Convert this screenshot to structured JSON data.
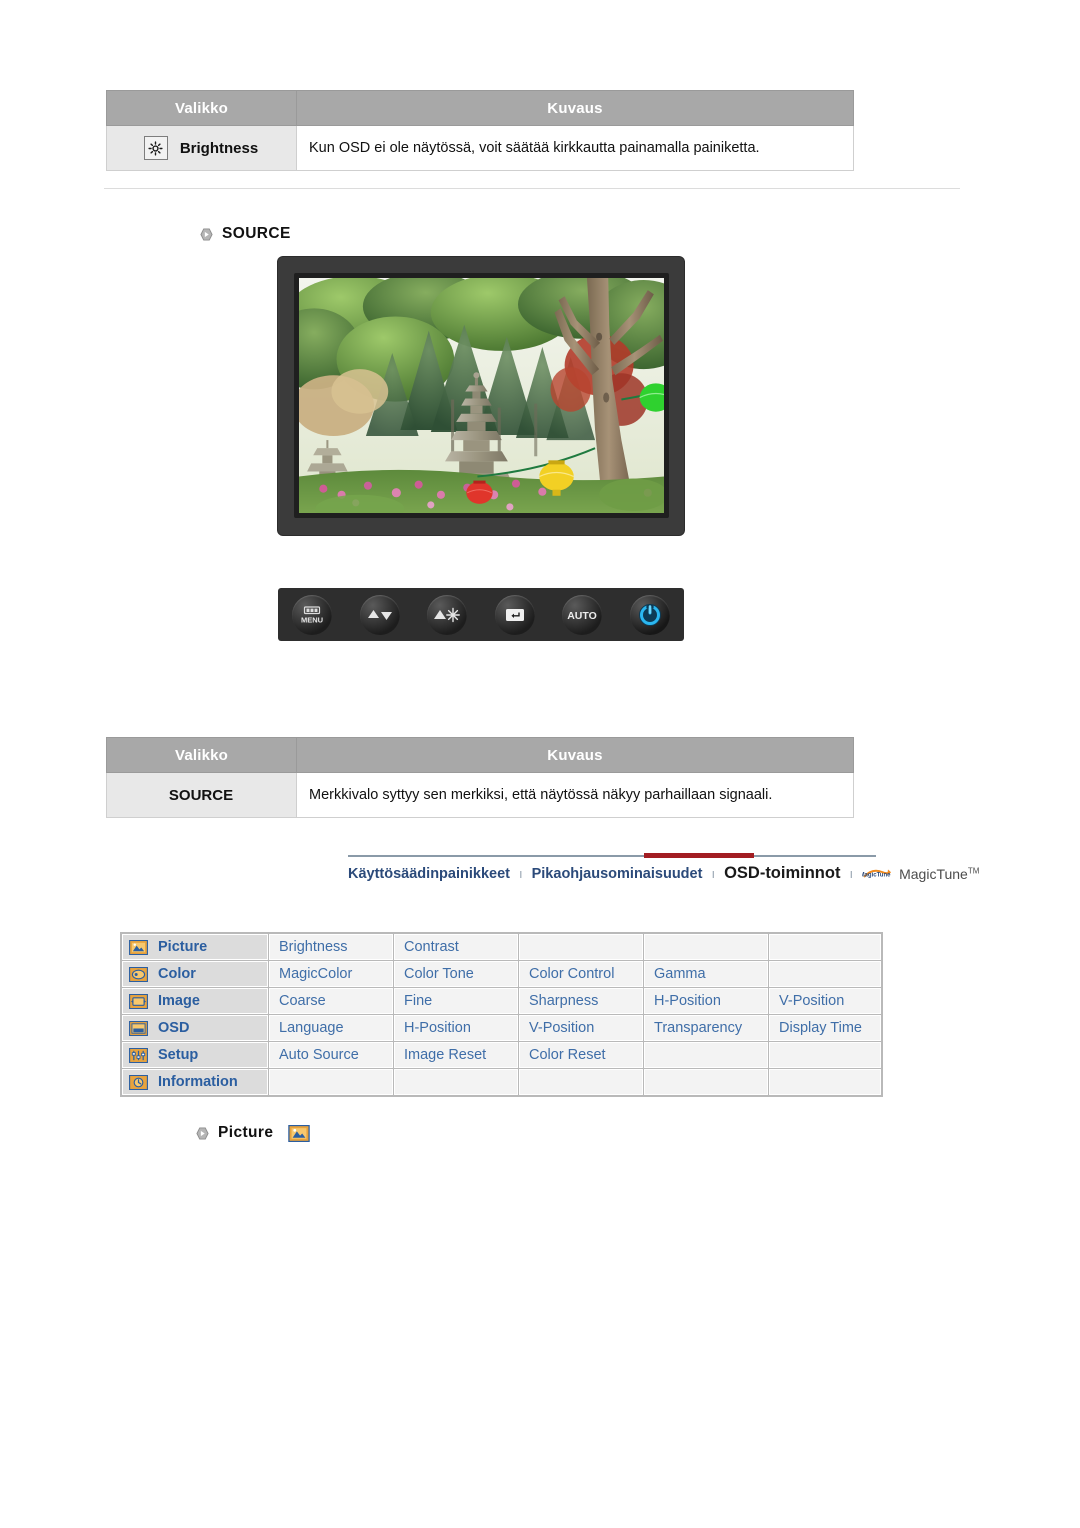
{
  "brightness_table": {
    "headers": [
      "Valikko",
      "Kuvaus"
    ],
    "rows": [
      {
        "icon": "brightness-sun-icon",
        "menu": "Brightness",
        "description": "Kun OSD ei ole näytössä, voit säätää kirkkautta painamalla painiketta."
      }
    ]
  },
  "source_section": {
    "heading": "SOURCE",
    "bullet_icon": "hex-bullet-icon",
    "monitor": {
      "name": "monitor-screenshot",
      "screen_caption": "Korean garden photo with stone pagoda, trees, flowers and paper lanterns"
    },
    "buttons": [
      {
        "name": "menu-button",
        "label": "MENU",
        "icon": "menu-bars-icon"
      },
      {
        "name": "down-up-button",
        "label": "",
        "icon": "up-down-arrow-icon"
      },
      {
        "name": "brightness-button",
        "label": "",
        "icon": "brightness-sun-icon"
      },
      {
        "name": "enter-source-button",
        "label": "",
        "icon": "enter-screen-icon"
      },
      {
        "name": "auto-button",
        "label": "AUTO",
        "icon": "auto-text-icon"
      },
      {
        "name": "power-button",
        "label": "",
        "icon": "power-icon",
        "color": "#1e9ee0"
      }
    ]
  },
  "source_table": {
    "headers": [
      "Valikko",
      "Kuvaus"
    ],
    "rows": [
      {
        "menu": "SOURCE",
        "description": "Merkkivalo syttyy sen merkiksi, että näytössä näkyy parhaillaan signaali."
      }
    ]
  },
  "nav": {
    "items": [
      {
        "label": "Käyttösäädinpainikkeet",
        "active": false
      },
      {
        "label": "Pikaohjausominaisuudet",
        "active": false
      },
      {
        "label": "OSD-toiminnot",
        "active": true
      }
    ],
    "separator": "ı",
    "magictune": {
      "label": "MagicTune",
      "tm": "TM",
      "logo_text": "MagicTune"
    },
    "accent_color": "#a21d22",
    "rule_color": "#8a9aa8"
  },
  "osd_matrix": {
    "rows": [
      {
        "icon": "picture-icon",
        "category": "Picture",
        "items": [
          "Brightness",
          "Contrast",
          "",
          "",
          ""
        ]
      },
      {
        "icon": "color-icon",
        "category": "Color",
        "items": [
          "MagicColor",
          "Color Tone",
          "Color Control",
          "Gamma",
          ""
        ]
      },
      {
        "icon": "image-icon",
        "category": "Image",
        "items": [
          "Coarse",
          "Fine",
          "Sharpness",
          "H-Position",
          "V-Position"
        ]
      },
      {
        "icon": "osd-icon",
        "category": "OSD",
        "items": [
          "Language",
          "H-Position",
          "V-Position",
          "Transparency",
          "Display Time"
        ]
      },
      {
        "icon": "setup-icon",
        "category": "Setup",
        "items": [
          "Auto Source",
          "Image Reset",
          "Color Reset",
          "",
          ""
        ]
      },
      {
        "icon": "information-icon",
        "category": "Information",
        "items": [
          "",
          "",
          "",
          "",
          ""
        ]
      }
    ]
  },
  "picture_section": {
    "heading": "Picture",
    "bullet_icon": "hex-bullet-icon",
    "badge_icon": "picture-icon"
  }
}
